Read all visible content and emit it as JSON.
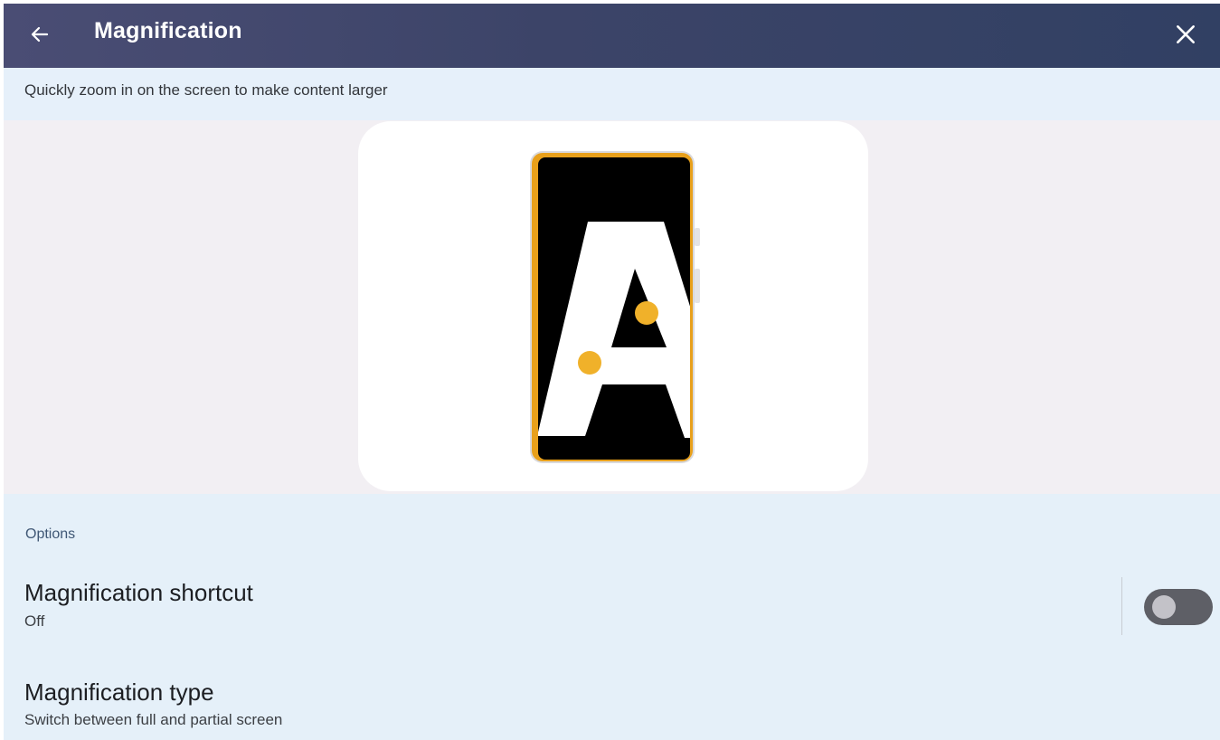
{
  "header": {
    "title": "Magnification",
    "back_icon": "arrow-back-icon",
    "close_icon": "close-icon"
  },
  "description": "Quickly zoom in on the screen to make content larger",
  "illustration": {
    "icon": "magnification-phone-illustration",
    "glyph": "A",
    "colors": {
      "phone_border": "#e8a01b",
      "screen": "#000000",
      "letter": "#ffffff",
      "touch_point": "#f0b12a"
    }
  },
  "options": {
    "section_label": "Options",
    "items": [
      {
        "title": "Magnification shortcut",
        "subtitle": "Off",
        "toggle_on": false
      },
      {
        "title": "Magnification type",
        "subtitle": "Switch between full and partial screen"
      }
    ]
  },
  "colors": {
    "header_bg": "#3c4468",
    "page_bg": "#e5f0f9",
    "illustration_bg": "#f2eff3",
    "toggle_track": "#5e5f66"
  }
}
